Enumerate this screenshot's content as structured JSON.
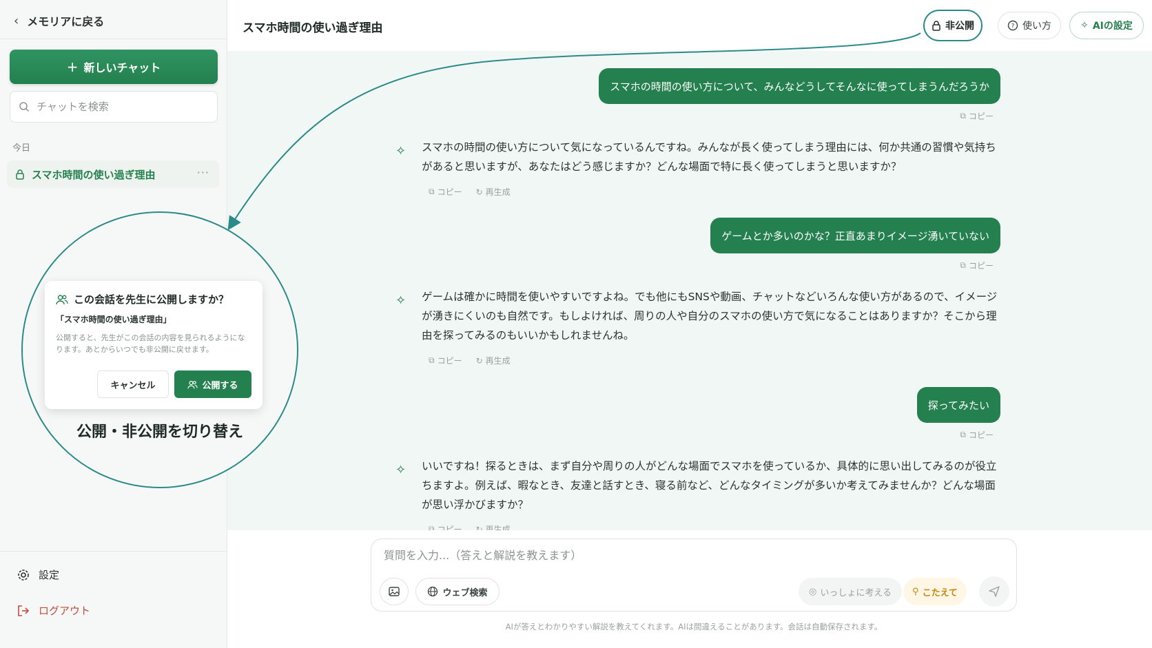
{
  "sidebar": {
    "back_label": "メモリアに戻る",
    "new_chat_label": "新しいチャット",
    "search_placeholder": "チャットを検索",
    "section_today": "今日",
    "chat_items": [
      {
        "label": "スマホ時間の使い過ぎ理由"
      }
    ],
    "settings_label": "設定",
    "logout_label": "ログアウト"
  },
  "modal": {
    "title": "この会話を先生に公開しますか？",
    "chat_name": "「スマホ時間の使い過ぎ理由」",
    "body": "公開すると、先生がこの会話の内容を見られるようになります。あとからいつでも非公開に戻せます。",
    "cancel_label": "キャンセル",
    "publish_label": "公開する"
  },
  "callout_caption": "公開・非公開を切り替え",
  "header": {
    "title": "スマホ時間の使い過ぎ理由",
    "private_label": "非公開",
    "howto_label": "使い方",
    "ai_settings_label": "AIの設定"
  },
  "messages": [
    {
      "role": "user",
      "text": "スマホの時間の使い方について、みんなどうしてそんなに使ってしまうんだろうか",
      "copy": "コピー"
    },
    {
      "role": "assistant",
      "text": "スマホの時間の使い方について気になっているんですね。みんなが長く使ってしまう理由には、何か共通の習慣や気持ちがあると思いますが、あなたはどう感じますか？どんな場面で特に長く使ってしまうと思いますか？",
      "copy": "コピー",
      "regen": "再生成"
    },
    {
      "role": "user",
      "text": "ゲームとか多いのかな？正直あまりイメージ湧いていない",
      "copy": "コピー"
    },
    {
      "role": "assistant",
      "text": "ゲームは確かに時間を使いやすいですよね。でも他にもSNSや動画、チャットなどいろんな使い方があるので、イメージが湧きにくいのも自然です。もしよければ、周りの人や自分のスマホの使い方で気になることはありますか？そこから理由を探ってみるのもいいかもしれませんね。",
      "copy": "コピー",
      "regen": "再生成"
    },
    {
      "role": "user",
      "text": "探ってみたい",
      "copy": "コピー"
    },
    {
      "role": "assistant",
      "text": "いいですね！探るときは、まず自分や周りの人がどんな場面でスマホを使っているか、具体的に思い出してみるのが役立ちますよ。例えば、暇なとき、友達と話すとき、寝る前など、どんなタイミングが多いか考えてみませんか？どんな場面が思い浮かびますか？",
      "copy": "コピー",
      "regen": "再生成"
    }
  ],
  "composer": {
    "placeholder": "質問を入力...（答えと解説を教えます）",
    "web_search_label": "ウェブ検索",
    "think_together_label": "いっしょに考える",
    "answer_label": "こたえて",
    "disclaimer": "AIが答えとわかりやすい解説を教えてくれます。AIは間違えることがあります。会話は自動保存されます。"
  },
  "colors": {
    "accent": "#24804f",
    "callout": "#2a8b88",
    "chat_bg": "#f1f7f4",
    "danger": "#c44a3a"
  }
}
